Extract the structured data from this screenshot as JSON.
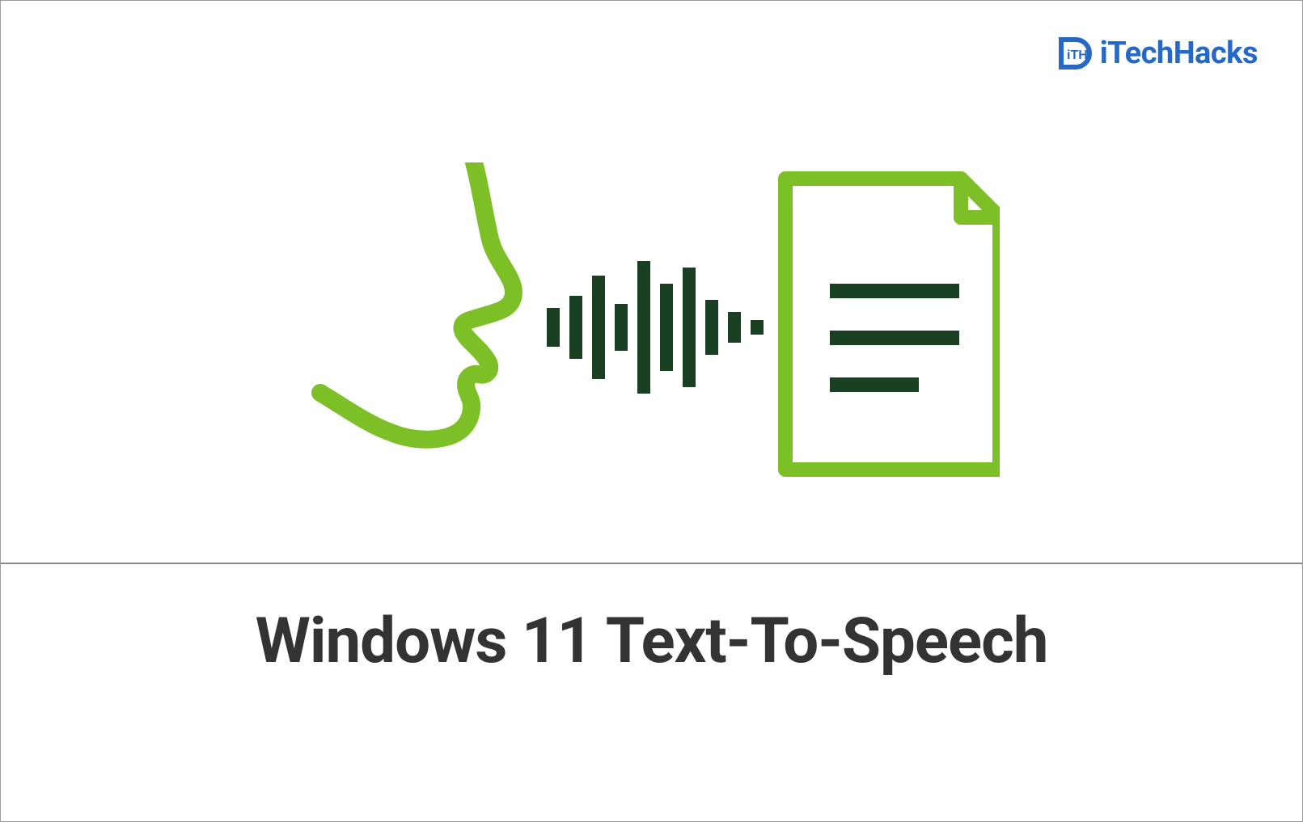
{
  "brand": {
    "name": "iTechHacks",
    "color_primary": "#2668c6"
  },
  "title": "Windows 11 Text-To-Speech",
  "illustration": {
    "face_color": "#7cbf26",
    "wave_color": "#1a4024",
    "document_stroke": "#7cbf26",
    "document_lines_color": "#1a4024"
  }
}
